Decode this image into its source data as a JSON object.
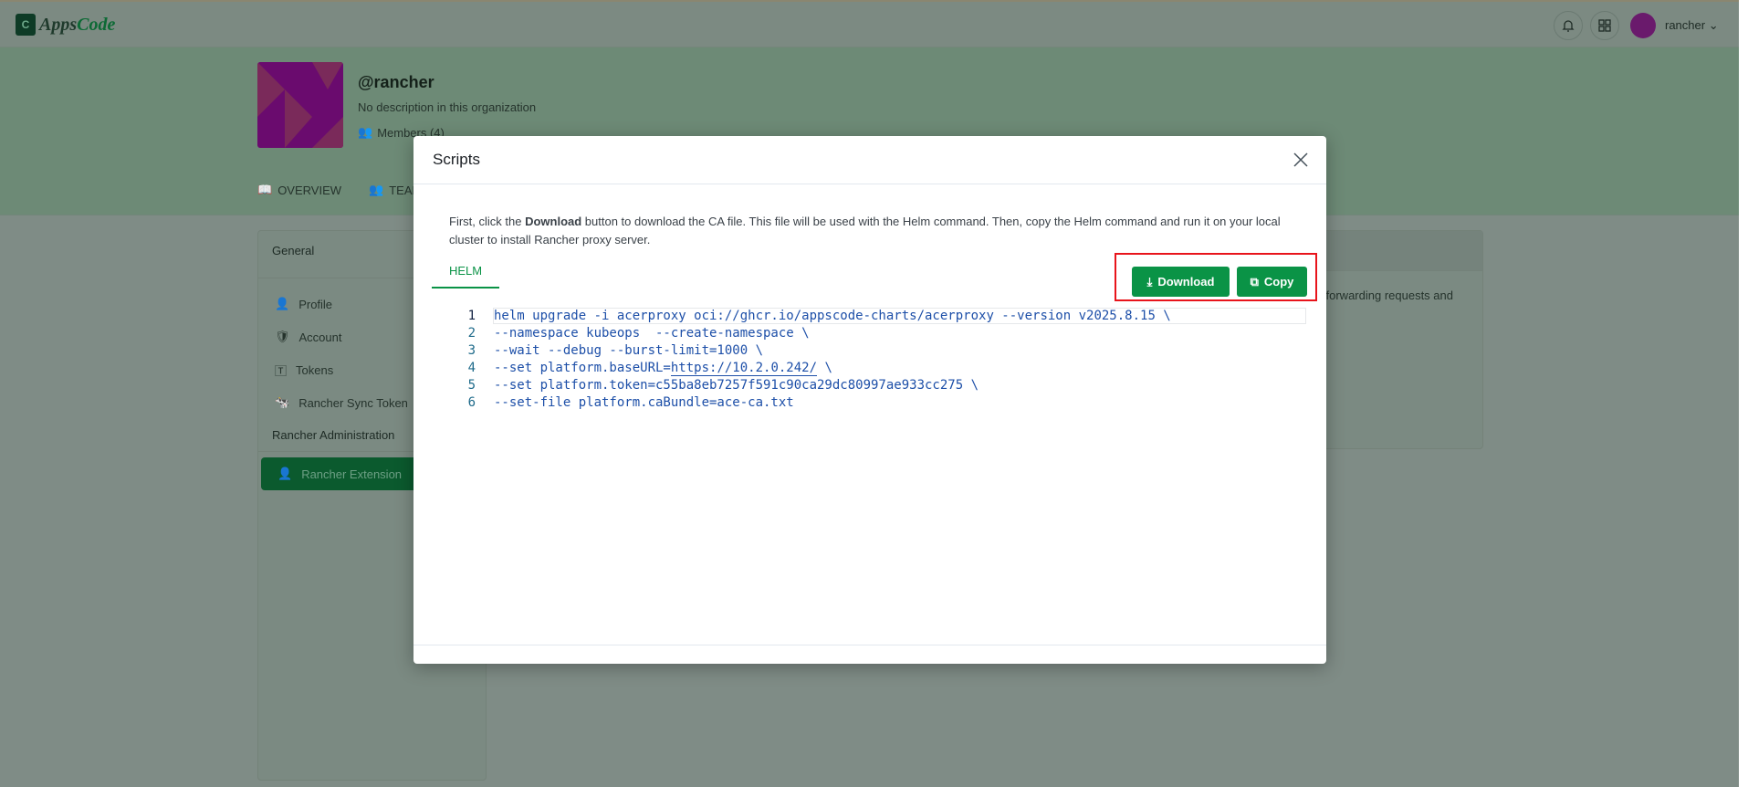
{
  "header": {
    "brand": "AppsCode",
    "brand_a": "Apps",
    "brand_b": "Code",
    "user": "rancher",
    "icons": [
      "bell-icon",
      "grid-icon",
      "chevron-down-icon"
    ]
  },
  "org": {
    "name": "@rancher",
    "description": "No description in this organization",
    "members": "Members (4)",
    "tabs": [
      "OVERVIEW",
      "TEAMS"
    ]
  },
  "sidebar": {
    "general": "General",
    "items": [
      "Profile",
      "Account",
      "Tokens",
      "Rancher Sync Token"
    ],
    "admin": "Rancher Administration",
    "active": "Rancher Extension"
  },
  "card": {
    "text_fragment": "forwarding requests and"
  },
  "modal": {
    "title": "Scripts",
    "desc_pre": "First, click the ",
    "desc_bold": "Download",
    "desc_post": " button to download the CA file. This file will be used with the Helm command. Then, copy the Helm command and run it on your local cluster to install Rancher proxy server.",
    "tab": "HELM",
    "download": "Download",
    "copy": "Copy",
    "code": [
      {
        "n": "1",
        "pre": "helm upgrade -i acerproxy oci://ghcr.io/appscode-charts/acerproxy --version v2025.8.15 \\"
      },
      {
        "n": "2",
        "pre": "--namespace kubeops  --create-namespace \\"
      },
      {
        "n": "3",
        "pre": "--wait --debug --burst-limit=1000 \\"
      },
      {
        "n": "4",
        "pre": "--set platform.baseURL=",
        "link": "https://10.2.0.242/",
        "post": " \\"
      },
      {
        "n": "5",
        "pre": "--set platform.token=c55ba8eb7257f591c90ca29dc80997ae933cc275 \\"
      },
      {
        "n": "6",
        "pre": "--set-file platform.caBundle=ace-ca.txt"
      }
    ]
  },
  "colors": {
    "accent": "#0a9346",
    "highlight": "#e8141b",
    "code": "#1d4fa8"
  }
}
